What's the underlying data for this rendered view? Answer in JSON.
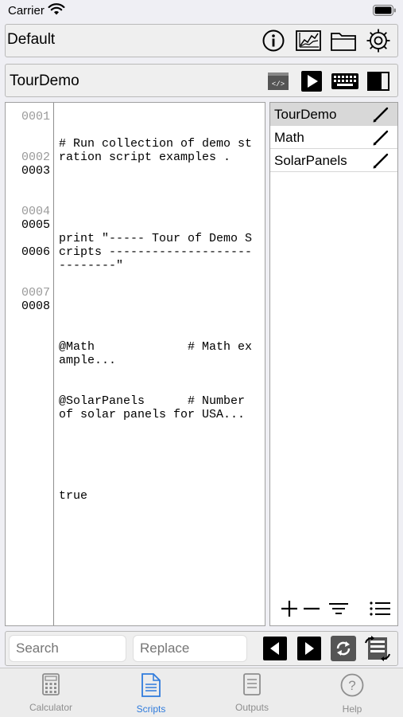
{
  "status": {
    "carrier": "Carrier"
  },
  "top_bar": {
    "title": "Default",
    "icons": [
      "info-icon",
      "chart-icon",
      "folder-icon",
      "gear-icon"
    ]
  },
  "script_bar": {
    "title": "TourDemo",
    "icons": [
      "code-icon",
      "play-icon",
      "keyboard-icon",
      "split-view-icon"
    ]
  },
  "editor": {
    "line_numbers": [
      "0001",
      "0002",
      "0003",
      "0004",
      "0005",
      "0006",
      "0007",
      "0008"
    ],
    "lines": [
      "# Run collection of demo stration script examples .",
      "",
      "print \"----- Tour of Demo Scripts ----------------------------\"",
      "",
      "@Math             # Math example...",
      "@SolarPanels      # Number of solar panels for USA...",
      "",
      "true"
    ]
  },
  "script_list": {
    "items": [
      {
        "label": "TourDemo",
        "selected": true
      },
      {
        "label": "Math",
        "selected": false
      },
      {
        "label": "SolarPanels",
        "selected": false
      }
    ]
  },
  "search": {
    "search_placeholder": "Search",
    "replace_placeholder": "Replace"
  },
  "tabs": [
    {
      "label": "Calculator",
      "icon": "calculator-icon",
      "active": false
    },
    {
      "label": "Scripts",
      "icon": "scripts-icon",
      "active": true
    },
    {
      "label": "Outputs",
      "icon": "outputs-icon",
      "active": false
    },
    {
      "label": "Help",
      "icon": "help-icon",
      "active": false
    }
  ],
  "colors": {
    "accent": "#2f7bdc",
    "inactive": "#8e8e8e"
  }
}
